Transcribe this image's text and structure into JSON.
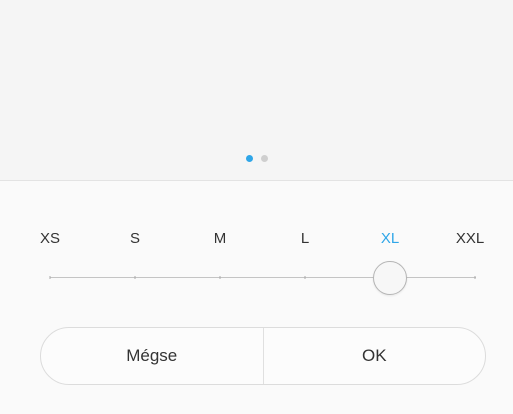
{
  "carousel": {
    "page_count": 2,
    "active_page": 1,
    "accent_color": "#2fa6e8",
    "inactive_color": "#cfcfcf"
  },
  "font_size_picker": {
    "options": [
      "XS",
      "S",
      "M",
      "L",
      "XL",
      "XXL"
    ],
    "selected": "XL",
    "selected_index": 4,
    "selected_color": "#2fa6e8"
  },
  "dialog_buttons": {
    "cancel_label": "Mégse",
    "ok_label": "OK"
  }
}
